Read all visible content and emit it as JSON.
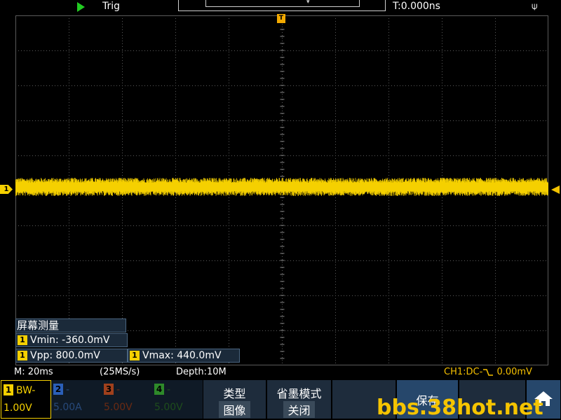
{
  "topbar": {
    "trig_label": "Trig",
    "time_offset": "T:0.000ns",
    "memory_pos_glyph": "▾",
    "usb_glyph": "⍦"
  },
  "screen": {
    "trigger_marker": "T",
    "ch1_marker": "1"
  },
  "measure_panel": {
    "title": "屏幕测量",
    "items": [
      {
        "channel": "1",
        "label": "Vmin: -360.0mV"
      },
      {
        "channel": "1",
        "label": "Vpp: 800.0mV"
      },
      {
        "channel": "1",
        "label": "Vmax: 440.0mV"
      }
    ]
  },
  "status": {
    "timebase": "M: 20ms",
    "samplerate": "(25MS/s)",
    "depth": "Depth:10M",
    "ch1_coupling": "CH1:DC-",
    "ch1_level": "0.00mV"
  },
  "channels": [
    {
      "num": "1",
      "tag": "BW-",
      "scale": "1.00V"
    },
    {
      "num": "2",
      "tag": "-",
      "scale": "5.00A"
    },
    {
      "num": "3",
      "tag": "-",
      "scale": "5.00V"
    },
    {
      "num": "4",
      "tag": "-",
      "scale": "5.00V"
    }
  ],
  "softkeys": {
    "type_label": "类型",
    "type_value": "图像",
    "savemode_label": "省墨模式",
    "savemode_value": "关闭",
    "save_label": "保存"
  },
  "watermark": "bbs.38hot.net",
  "colors": {
    "ch1": "#f5d000",
    "ch2": "#2b5fb8",
    "ch3": "#a0401c",
    "ch4": "#2e8a2a",
    "grid": "#5a5a5a",
    "trigger": "#f2a900"
  }
}
